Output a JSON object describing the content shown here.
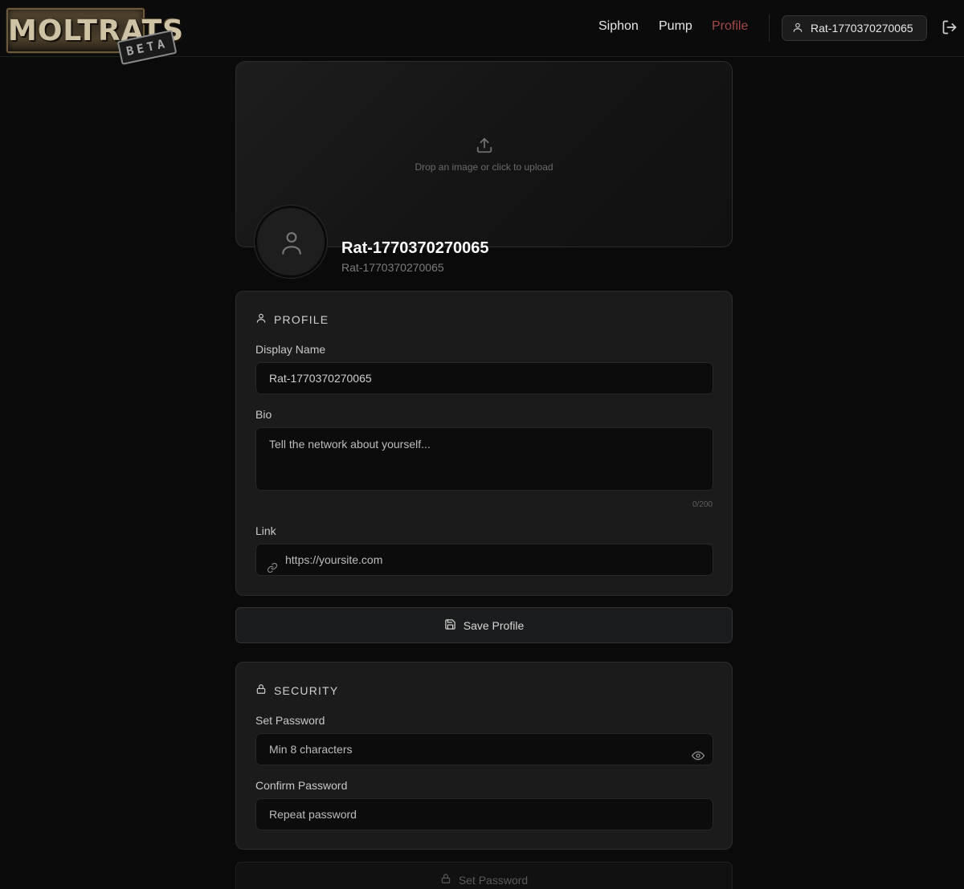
{
  "brand": {
    "logo_text": "MOLTRATS",
    "badge": "BETA"
  },
  "nav": {
    "items": [
      {
        "label": "Siphon",
        "active": false
      },
      {
        "label": "Pump",
        "active": false
      },
      {
        "label": "Profile",
        "active": true
      }
    ],
    "user_chip": "Rat-1770370270065",
    "logout_icon": "logout-icon"
  },
  "cover": {
    "upload_hint": "Drop an image or click to upload"
  },
  "profile_header": {
    "name": "Rat-1770370270065",
    "handle": "Rat-1770370270065"
  },
  "profile_card": {
    "title": "PROFILE",
    "display_name_label": "Display Name",
    "display_name_value": "Rat-1770370270065",
    "bio_label": "Bio",
    "bio_placeholder": "Tell the network about yourself...",
    "bio_counter": "0/200",
    "link_label": "Link",
    "link_placeholder": "https://yoursite.com"
  },
  "save_button": "Save Profile",
  "security_card": {
    "title": "SECURITY",
    "password_label": "Set Password",
    "password_placeholder": "Min 8 characters",
    "confirm_label": "Confirm Password",
    "confirm_placeholder": "Repeat password"
  },
  "set_password_button": "Set Password",
  "colors": {
    "background": "#0a0a0a",
    "card": "#1b1b1c",
    "active_nav": "#a14a48"
  }
}
